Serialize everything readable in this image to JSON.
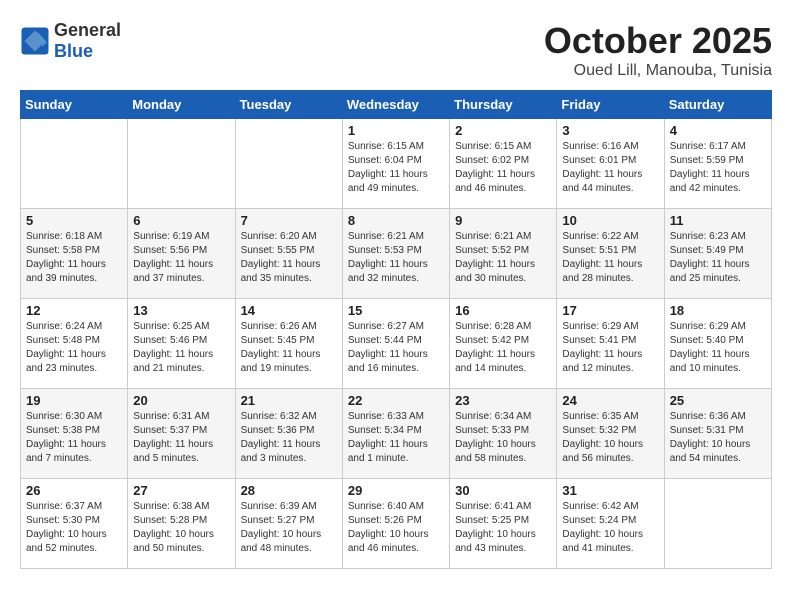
{
  "logo": {
    "general": "General",
    "blue": "Blue"
  },
  "header": {
    "month": "October 2025",
    "location": "Oued Lill, Manouba, Tunisia"
  },
  "weekdays": [
    "Sunday",
    "Monday",
    "Tuesday",
    "Wednesday",
    "Thursday",
    "Friday",
    "Saturday"
  ],
  "weeks": [
    [
      {
        "day": "",
        "info": ""
      },
      {
        "day": "",
        "info": ""
      },
      {
        "day": "",
        "info": ""
      },
      {
        "day": "1",
        "info": "Sunrise: 6:15 AM\nSunset: 6:04 PM\nDaylight: 11 hours and 49 minutes."
      },
      {
        "day": "2",
        "info": "Sunrise: 6:15 AM\nSunset: 6:02 PM\nDaylight: 11 hours and 46 minutes."
      },
      {
        "day": "3",
        "info": "Sunrise: 6:16 AM\nSunset: 6:01 PM\nDaylight: 11 hours and 44 minutes."
      },
      {
        "day": "4",
        "info": "Sunrise: 6:17 AM\nSunset: 5:59 PM\nDaylight: 11 hours and 42 minutes."
      }
    ],
    [
      {
        "day": "5",
        "info": "Sunrise: 6:18 AM\nSunset: 5:58 PM\nDaylight: 11 hours and 39 minutes."
      },
      {
        "day": "6",
        "info": "Sunrise: 6:19 AM\nSunset: 5:56 PM\nDaylight: 11 hours and 37 minutes."
      },
      {
        "day": "7",
        "info": "Sunrise: 6:20 AM\nSunset: 5:55 PM\nDaylight: 11 hours and 35 minutes."
      },
      {
        "day": "8",
        "info": "Sunrise: 6:21 AM\nSunset: 5:53 PM\nDaylight: 11 hours and 32 minutes."
      },
      {
        "day": "9",
        "info": "Sunrise: 6:21 AM\nSunset: 5:52 PM\nDaylight: 11 hours and 30 minutes."
      },
      {
        "day": "10",
        "info": "Sunrise: 6:22 AM\nSunset: 5:51 PM\nDaylight: 11 hours and 28 minutes."
      },
      {
        "day": "11",
        "info": "Sunrise: 6:23 AM\nSunset: 5:49 PM\nDaylight: 11 hours and 25 minutes."
      }
    ],
    [
      {
        "day": "12",
        "info": "Sunrise: 6:24 AM\nSunset: 5:48 PM\nDaylight: 11 hours and 23 minutes."
      },
      {
        "day": "13",
        "info": "Sunrise: 6:25 AM\nSunset: 5:46 PM\nDaylight: 11 hours and 21 minutes."
      },
      {
        "day": "14",
        "info": "Sunrise: 6:26 AM\nSunset: 5:45 PM\nDaylight: 11 hours and 19 minutes."
      },
      {
        "day": "15",
        "info": "Sunrise: 6:27 AM\nSunset: 5:44 PM\nDaylight: 11 hours and 16 minutes."
      },
      {
        "day": "16",
        "info": "Sunrise: 6:28 AM\nSunset: 5:42 PM\nDaylight: 11 hours and 14 minutes."
      },
      {
        "day": "17",
        "info": "Sunrise: 6:29 AM\nSunset: 5:41 PM\nDaylight: 11 hours and 12 minutes."
      },
      {
        "day": "18",
        "info": "Sunrise: 6:29 AM\nSunset: 5:40 PM\nDaylight: 11 hours and 10 minutes."
      }
    ],
    [
      {
        "day": "19",
        "info": "Sunrise: 6:30 AM\nSunset: 5:38 PM\nDaylight: 11 hours and 7 minutes."
      },
      {
        "day": "20",
        "info": "Sunrise: 6:31 AM\nSunset: 5:37 PM\nDaylight: 11 hours and 5 minutes."
      },
      {
        "day": "21",
        "info": "Sunrise: 6:32 AM\nSunset: 5:36 PM\nDaylight: 11 hours and 3 minutes."
      },
      {
        "day": "22",
        "info": "Sunrise: 6:33 AM\nSunset: 5:34 PM\nDaylight: 11 hours and 1 minute."
      },
      {
        "day": "23",
        "info": "Sunrise: 6:34 AM\nSunset: 5:33 PM\nDaylight: 10 hours and 58 minutes."
      },
      {
        "day": "24",
        "info": "Sunrise: 6:35 AM\nSunset: 5:32 PM\nDaylight: 10 hours and 56 minutes."
      },
      {
        "day": "25",
        "info": "Sunrise: 6:36 AM\nSunset: 5:31 PM\nDaylight: 10 hours and 54 minutes."
      }
    ],
    [
      {
        "day": "26",
        "info": "Sunrise: 6:37 AM\nSunset: 5:30 PM\nDaylight: 10 hours and 52 minutes."
      },
      {
        "day": "27",
        "info": "Sunrise: 6:38 AM\nSunset: 5:28 PM\nDaylight: 10 hours and 50 minutes."
      },
      {
        "day": "28",
        "info": "Sunrise: 6:39 AM\nSunset: 5:27 PM\nDaylight: 10 hours and 48 minutes."
      },
      {
        "day": "29",
        "info": "Sunrise: 6:40 AM\nSunset: 5:26 PM\nDaylight: 10 hours and 46 minutes."
      },
      {
        "day": "30",
        "info": "Sunrise: 6:41 AM\nSunset: 5:25 PM\nDaylight: 10 hours and 43 minutes."
      },
      {
        "day": "31",
        "info": "Sunrise: 6:42 AM\nSunset: 5:24 PM\nDaylight: 10 hours and 41 minutes."
      },
      {
        "day": "",
        "info": ""
      }
    ]
  ]
}
